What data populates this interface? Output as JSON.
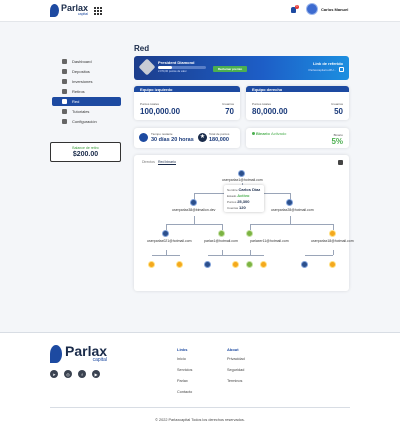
{
  "header": {
    "logo_text": "Parlax",
    "logo_sub": "capital",
    "notifications_count": "1",
    "user_name": "Carlos Manuel"
  },
  "sidebar": {
    "items": [
      {
        "label": "Dashboard",
        "icon": "dashboard-icon"
      },
      {
        "label": "Depositos",
        "icon": "deposit-icon"
      },
      {
        "label": "Inversiones",
        "icon": "investment-icon"
      },
      {
        "label": "Retiros",
        "icon": "withdraw-icon"
      },
      {
        "label": "Red",
        "icon": "network-icon"
      },
      {
        "label": "Tutoriales",
        "icon": "tutorial-icon"
      },
      {
        "label": "Configuración",
        "icon": "settings-icon"
      }
    ],
    "balance_label": "Balance de retiro",
    "balance_value": "$200.00"
  },
  "main": {
    "page_title": "Red",
    "rank": {
      "name": "President Diamond",
      "progress_text": "2.070,00 puntos de valor",
      "progress": 0.3,
      "button": "Reclamar premio"
    },
    "referral": {
      "title": "Link de referido",
      "link": "Parlaxcapital.io/#U..."
    },
    "left_team": {
      "title": "Equipo izquierdo",
      "points_label": "Puntos totales",
      "points": "100,000.00",
      "users_label": "Usuarios",
      "users": "70"
    },
    "right_team": {
      "title": "Equipo derecho",
      "points_label": "Puntos totales",
      "points": "80,000.00",
      "users_label": "Usuarios",
      "users": "50"
    },
    "timer": {
      "label": "Tiempo restante",
      "value": "30 días 20 horas"
    },
    "total_points": {
      "label": "Total de puntos",
      "value": "180,000"
    },
    "binary": {
      "label": "Binario",
      "status": "Activado"
    },
    "binary_pct": {
      "label": "Binario",
      "value": "5%"
    },
    "tree": {
      "tabs": [
        "Directos",
        "Red binario"
      ],
      "root": "userparlax1@hotmail.com",
      "popup": {
        "nombre_label": "Nombre",
        "nombre": "Carlos Díaz",
        "estado_label": "Estado",
        "estado": "Activo",
        "puntos_label": "Puntos",
        "puntos": "25,300",
        "cuentas_label": "Cuentas",
        "cuentas": "120"
      },
      "level2": [
        "userparlax38@bimalion.dev",
        "userparlax28@hotmail.com"
      ],
      "level3": [
        "userparlax021@hotmail.com",
        "parlax1@hotmail.com",
        "parlaxer11@hotmail.com",
        "userparlax18@hotmail.com"
      ]
    }
  },
  "footer": {
    "logo_text": "Parlax",
    "logo_sub": "capital",
    "links_title": "Links",
    "links": [
      "Inicio",
      "Servicios",
      "Parlax",
      "Contacto"
    ],
    "about_title": "About",
    "about": [
      "Privacidad",
      "Seguridad",
      "Terminos"
    ],
    "copyright": "© 2022 Parlaxcapital Todos los derechos reservados."
  },
  "colors": {
    "primary": "#1d4aa1",
    "accent_green": "#4caf50",
    "dark": "#1a2b4a"
  }
}
